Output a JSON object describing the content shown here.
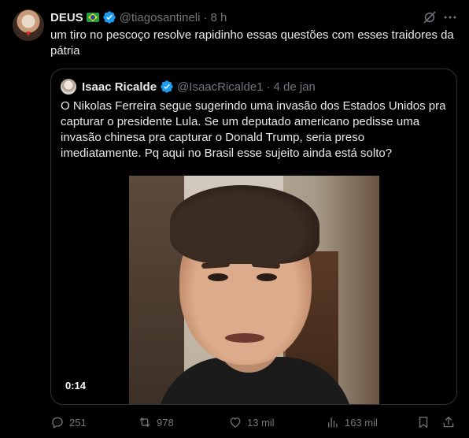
{
  "tweet": {
    "author_name": "DEUS",
    "author_flag_icon": "brazil-flag-icon",
    "verified_icon": "verified-badge-icon",
    "handle": "@tiagosantineli",
    "separator": "·",
    "time": "8 h",
    "text": "um tiro no pescoço resolve rapidinho essas questões com esses traidores da pátria"
  },
  "quote": {
    "author_name": "Isaac Ricalde",
    "handle": "@IsaacRicalde1",
    "separator": "·",
    "time": "4 de jan",
    "text": "O Nikolas Ferreira segue sugerindo uma invasão dos Estados Unidos pra capturar o presidente Lula. Se um deputado americano pedisse uma invasão chinesa pra capturar o Donald Trump, seria preso imediatamente. Pq aqui no Brasil esse sujeito ainda está solto?",
    "video_duration": "0:14"
  },
  "actions": {
    "replies": "251",
    "reposts": "978",
    "likes": "13 mil",
    "views": "163 mil"
  },
  "colors": {
    "background": "#000000",
    "text_primary": "#e7e9ea",
    "text_secondary": "#71767b",
    "verified": "#1d9bf0",
    "border": "#2f3336"
  }
}
